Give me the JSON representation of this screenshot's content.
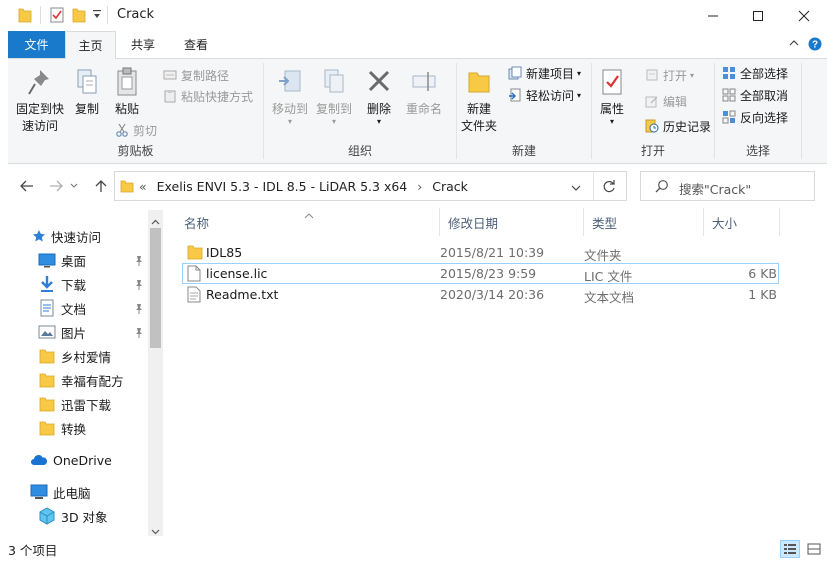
{
  "window": {
    "title": "Crack"
  },
  "ribbon_tabs": [
    "文件",
    "主页",
    "共享",
    "查看"
  ],
  "ribbon": {
    "clipboard": {
      "label": "剪贴板",
      "pin_quick_access": "固定到快\n速访问",
      "copy": "复制",
      "paste": "粘贴",
      "copy_path": "复制路径",
      "paste_shortcut": "粘贴快捷方式",
      "cut": "剪切"
    },
    "organize": {
      "label": "组织",
      "move_to": "移动到",
      "copy_to": "复制到",
      "delete": "删除",
      "rename": "重命名"
    },
    "new": {
      "label": "新建",
      "new_folder": "新建\n文件夹",
      "new_item": "新建项目",
      "easy_access": "轻松访问"
    },
    "open": {
      "label": "打开",
      "properties": "属性",
      "open": "打开",
      "edit": "编辑",
      "history": "历史记录"
    },
    "select": {
      "label": "选择",
      "select_all": "全部选择",
      "select_none": "全部取消",
      "invert": "反向选择"
    }
  },
  "address": {
    "prefix": "«",
    "path": [
      "Exelis ENVI 5.3 - IDL 8.5 - LiDAR 5.3 x64",
      "Crack"
    ],
    "separator": "›",
    "search_placeholder": "搜索\"Crack\""
  },
  "nav_pane": {
    "quick_access": "快速访问",
    "items": [
      {
        "label": "桌面",
        "icon": "desktop-icon",
        "pinned": true
      },
      {
        "label": "下载",
        "icon": "download-icon",
        "pinned": true
      },
      {
        "label": "文档",
        "icon": "document-icon",
        "pinned": true
      },
      {
        "label": "图片",
        "icon": "picture-icon",
        "pinned": true
      },
      {
        "label": "乡村爱情",
        "icon": "folder-icon",
        "pinned": false
      },
      {
        "label": "幸福有配方",
        "icon": "folder-icon",
        "pinned": false
      },
      {
        "label": "迅雷下载",
        "icon": "folder-icon",
        "pinned": false
      },
      {
        "label": "转换",
        "icon": "folder-icon",
        "pinned": false
      }
    ],
    "onedrive": "OneDrive",
    "this_pc": "此电脑",
    "objects_3d": "3D 对象"
  },
  "columns": {
    "name": "名称",
    "date": "修改日期",
    "type": "类型",
    "size": "大小"
  },
  "files": [
    {
      "name": "IDL85",
      "date": "2015/8/21 10:39",
      "type": "文件夹",
      "size": "",
      "icon": "folder-icon"
    },
    {
      "name": "license.lic",
      "date": "2015/8/23 9:59",
      "type": "LIC 文件",
      "size": "6 KB",
      "icon": "file-icon"
    },
    {
      "name": "Readme.txt",
      "date": "2020/3/14 20:36",
      "type": "文本文档",
      "size": "1 KB",
      "icon": "text-file-icon"
    }
  ],
  "status": {
    "item_count": "3 个项目"
  },
  "colors": {
    "accent": "#1979ca",
    "folder": "#f8c945",
    "selection_border": "#99d1ff"
  }
}
